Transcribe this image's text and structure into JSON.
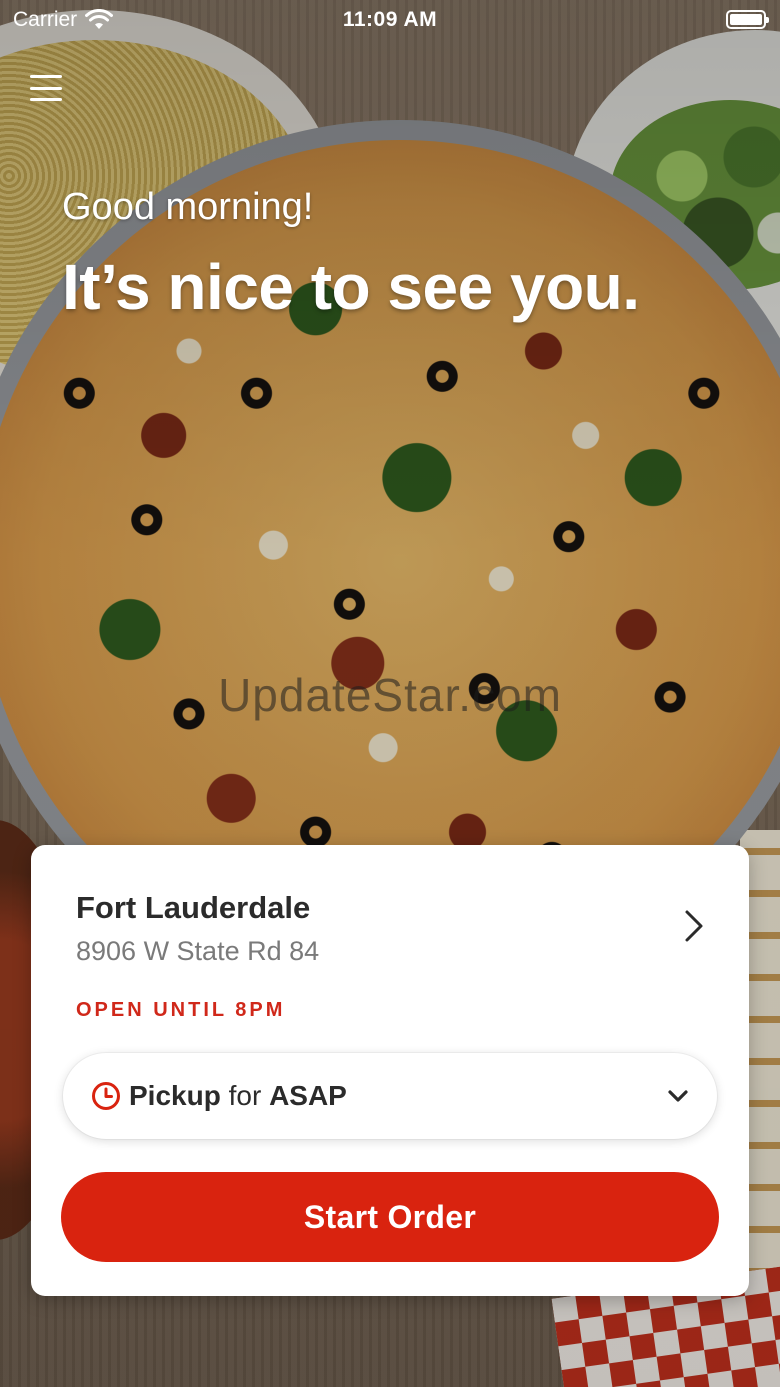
{
  "status_bar": {
    "carrier": "Carrier",
    "time": "11:09 AM",
    "wifi_icon": "wifi-icon",
    "battery_icon": "battery-full-icon"
  },
  "header": {
    "menu_icon": "hamburger-menu-icon",
    "greeting": "Good morning!",
    "headline": "It’s nice to see you."
  },
  "watermark": "UpdateStar.com",
  "location_card": {
    "store_name": "Fort Lauderdale",
    "address": "8906 W State Rd 84",
    "open_status": "OPEN UNTIL 8PM",
    "order_type": {
      "mode": "Pickup",
      "connector": "for",
      "time": "ASAP"
    },
    "start_order_label": "Start Order"
  },
  "colors": {
    "brand_red": "#d9230f",
    "open_status_red": "#d0281a",
    "text_dark": "#2b2b2b",
    "text_muted": "#7a7a7a"
  }
}
